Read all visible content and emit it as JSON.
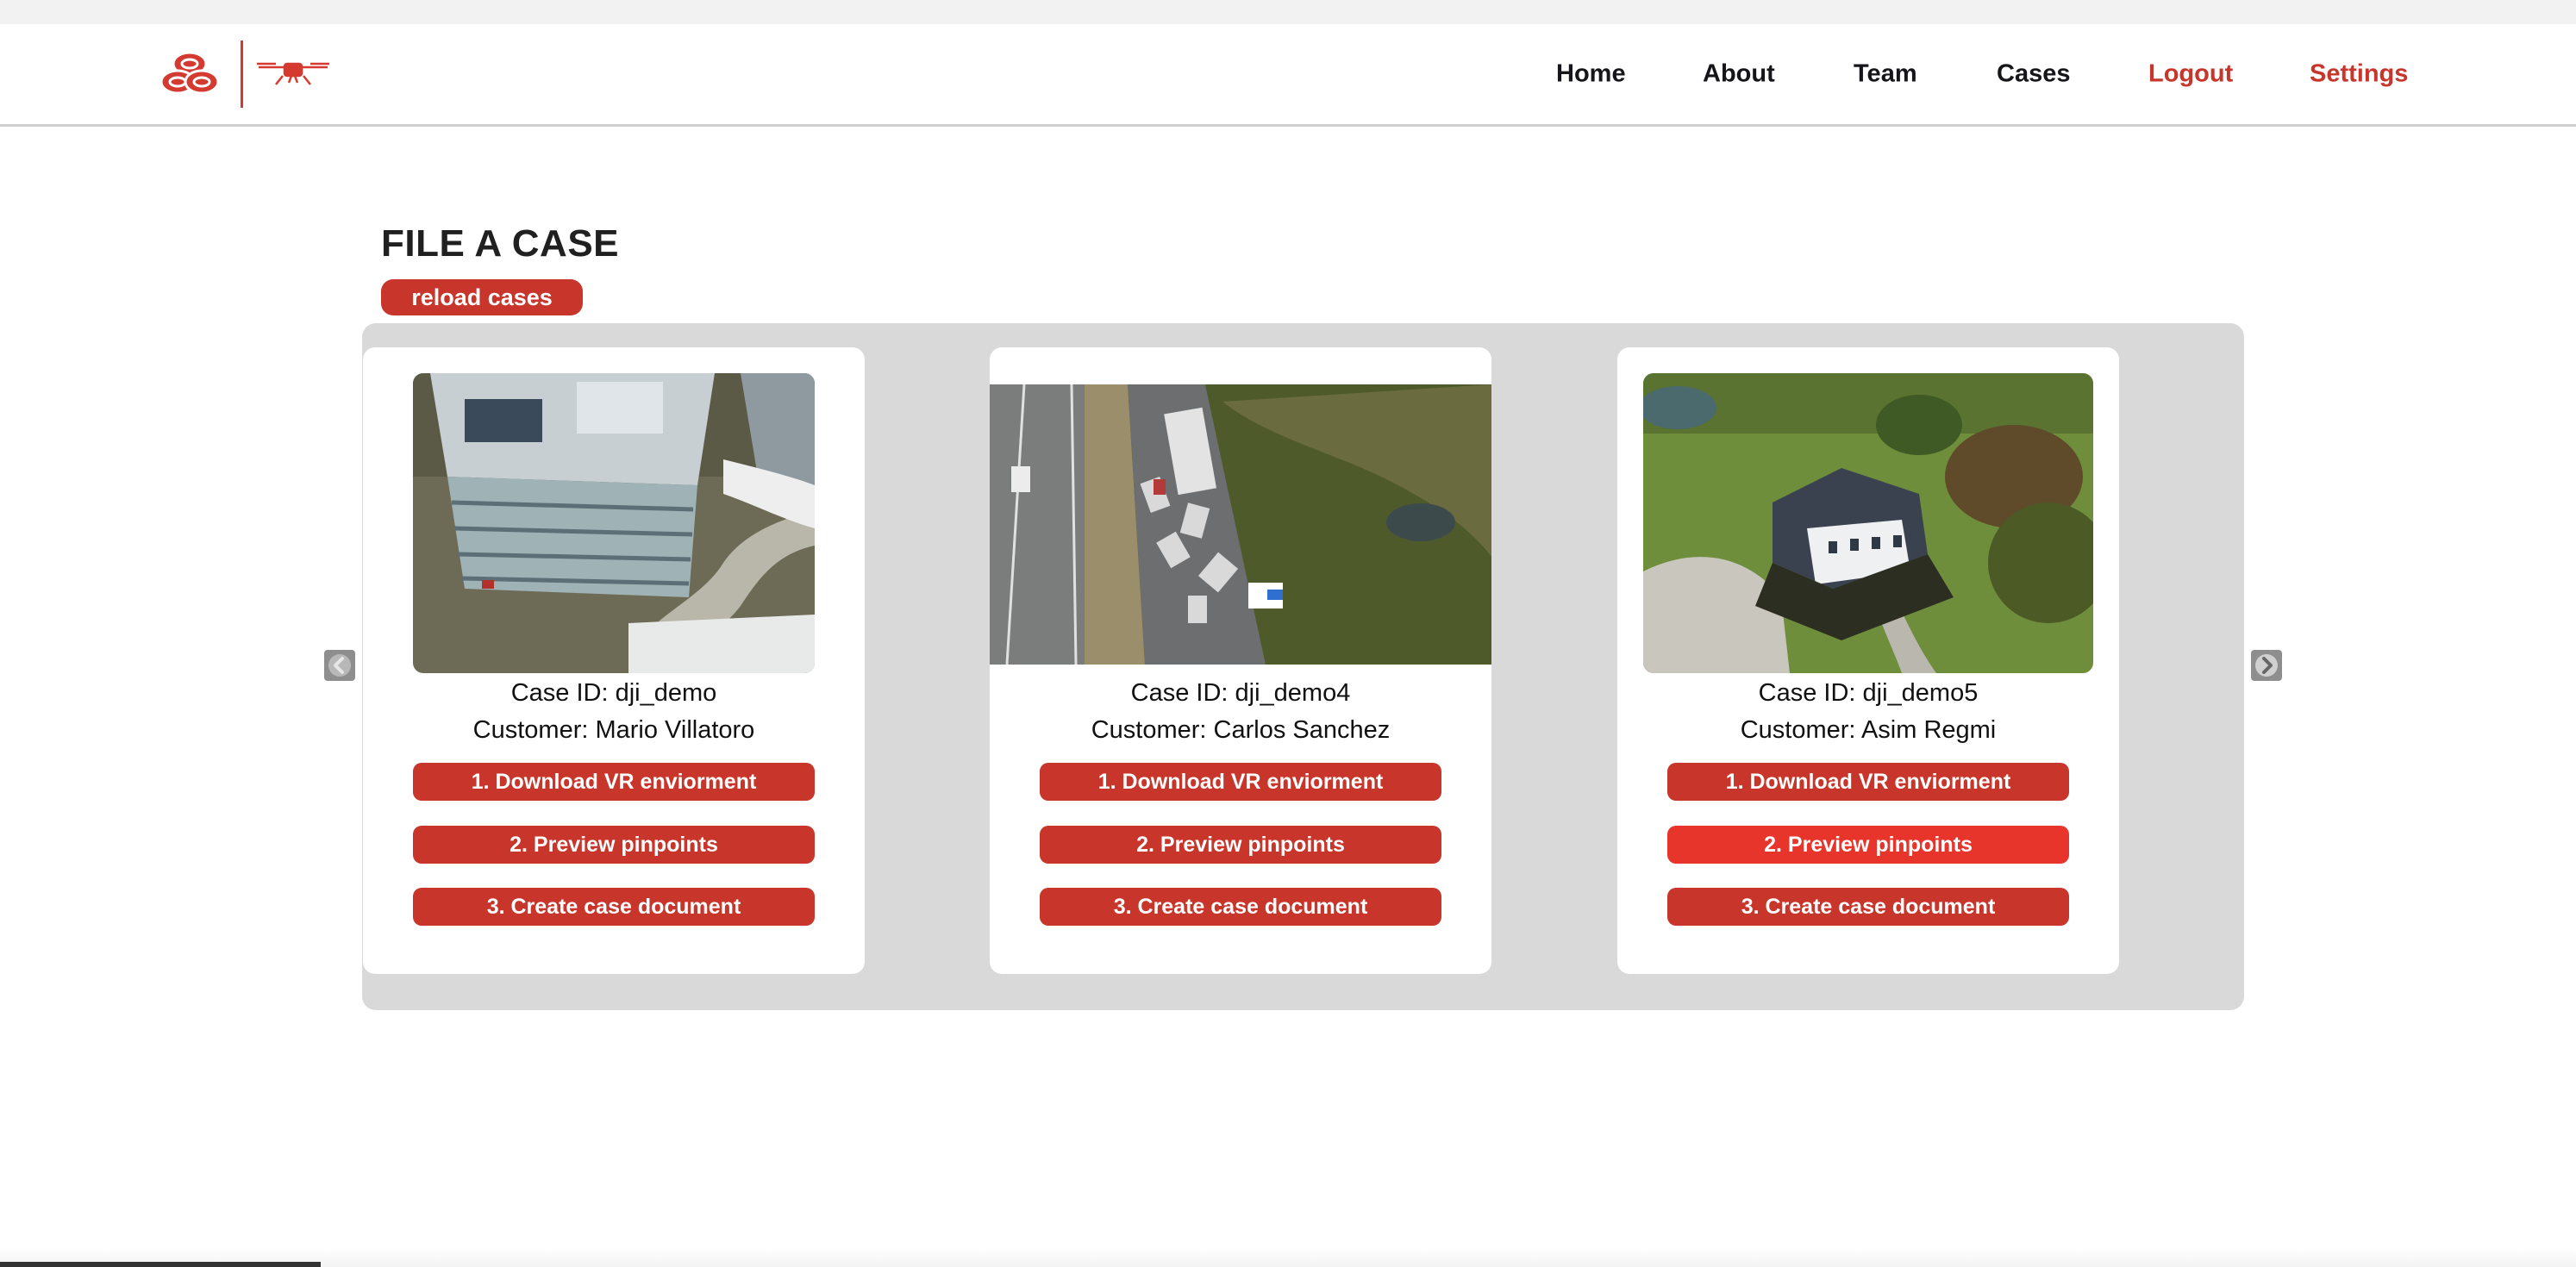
{
  "nav": {
    "home": "Home",
    "about": "About",
    "team": "Team",
    "cases": "Cases",
    "logout": "Logout",
    "settings": "Settings"
  },
  "page": {
    "title": "FILE A CASE",
    "reload_label": "reload cases"
  },
  "cases": [
    {
      "case_id": "Case ID: dji_demo",
      "customer": "Customer: Mario Villatoro",
      "buttons": [
        "1. Download VR enviorment",
        "2. Preview pinpoints",
        "3. Create case document"
      ]
    },
    {
      "case_id": "Case ID: dji_demo4",
      "customer": "Customer: Carlos Sanchez",
      "buttons": [
        "1. Download VR enviorment",
        "2. Preview pinpoints",
        "3. Create case document"
      ]
    },
    {
      "case_id": "Case ID: dji_demo5",
      "customer": "Customer: Asim Regmi",
      "buttons": [
        "1. Download VR enviorment",
        "2. Preview pinpoints",
        "3. Create case document"
      ]
    }
  ],
  "colors": {
    "brand_red": "#c8352b",
    "hover_red": "#e8352b",
    "carousel_bg": "#d9d9d9"
  },
  "icons": [
    "logo-rings-icon",
    "drone-icon",
    "chevron-left-icon",
    "chevron-right-icon"
  ]
}
